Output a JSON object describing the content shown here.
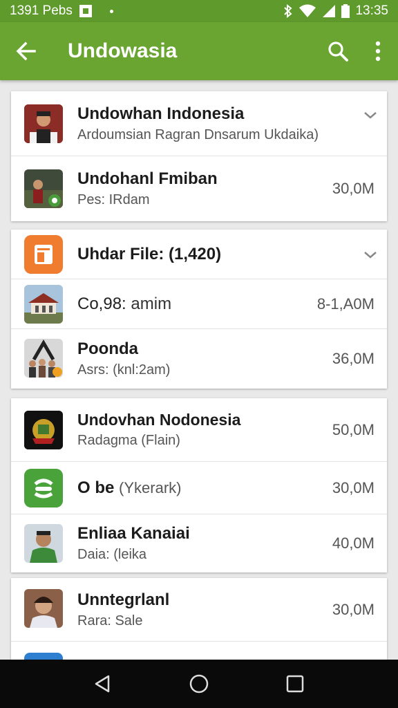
{
  "status_bar": {
    "left_text": "1391 Pebs",
    "time": "13:35"
  },
  "app_bar": {
    "title": "Undowasia",
    "icons": [
      "back-arrow-icon",
      "search-icon",
      "more-vert-icon"
    ]
  },
  "cards": [
    {
      "rows": [
        {
          "title": "Undowhan Indonesia",
          "subtitle": "Ardoumsian Ragran Dnsarum Ukdaika)",
          "size": "",
          "expandable": true,
          "thumb": "portrait-man"
        },
        {
          "title": "Undohanl Fmiban",
          "subtitle": "Pes: IRdam",
          "size": "30,0M",
          "expandable": false,
          "thumb": "group-photo"
        }
      ]
    },
    {
      "rows": [
        {
          "title": "Uhdar File: (1,420)",
          "subtitle": "",
          "size": "",
          "expandable": true,
          "thumb": "file-app"
        },
        {
          "title": "Co,98:",
          "title_extra": "amim",
          "subtitle": "",
          "size": "8-1,A0M",
          "expandable": false,
          "thumb": "building"
        },
        {
          "title": "Poonda",
          "subtitle": "Asrs: (knl:2am)",
          "size": "36,0M",
          "expandable": false,
          "thumb": "poonda"
        }
      ]
    },
    {
      "rows": [
        {
          "title": "Undovhan Nodonesia",
          "subtitle": "Radagma (Flain)",
          "size": "50,0M",
          "expandable": false,
          "thumb": "emblem"
        },
        {
          "title": "O be",
          "title_extra": "(Ykerark)",
          "subtitle": "",
          "size": "30,0M",
          "expandable": false,
          "thumb": "green-app"
        },
        {
          "title": "Enliaa Kanaiai",
          "subtitle": "Daia: (leika",
          "size": "40,0M",
          "expandable": false,
          "thumb": "portrait-green"
        }
      ]
    },
    {
      "rows": [
        {
          "title": "Unntegrlanl",
          "subtitle": "Rara: Sale",
          "size": "30,0M",
          "expandable": false,
          "thumb": "portrait-woman"
        },
        {
          "title": "",
          "subtitle": "",
          "size": "",
          "expandable": false,
          "thumb": "blue-app"
        }
      ]
    }
  ],
  "nav_bar": {
    "icons": [
      "back-triangle-icon",
      "home-circle-icon",
      "recents-square-icon"
    ]
  },
  "colors": {
    "status_bar": "#5f9a2c",
    "app_bar": "#6aa532",
    "background": "#e9e9e9",
    "card": "#ffffff"
  }
}
